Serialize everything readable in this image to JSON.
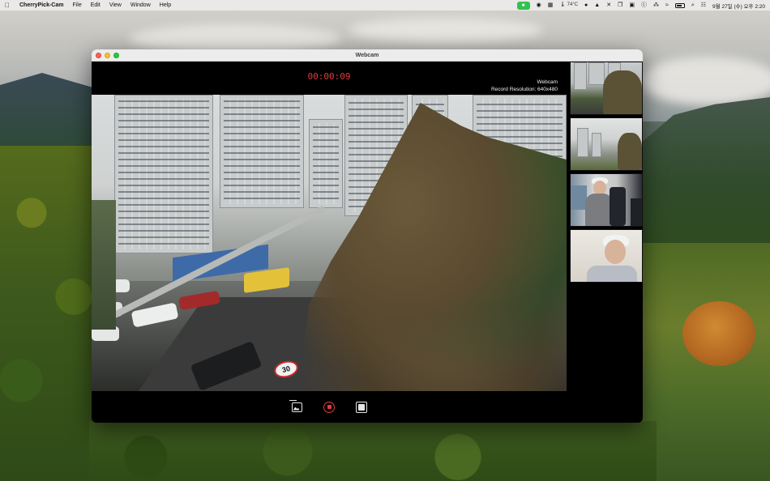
{
  "menubar": {
    "app_name": "CherryPick-Cam",
    "menus": [
      "File",
      "Edit",
      "View",
      "Window",
      "Help"
    ],
    "temperature": "74°C",
    "clock": "9월 27일 (수) 오후 2:20"
  },
  "window": {
    "title": "Webcam",
    "timer": "00:00:09",
    "source_name": "Webcam",
    "resolution_label": "Record Resolution: 640x480",
    "speed_sign": "30"
  },
  "colors": {
    "timer_red": "#e23a3a",
    "facetime_green": "#2fc34f"
  }
}
